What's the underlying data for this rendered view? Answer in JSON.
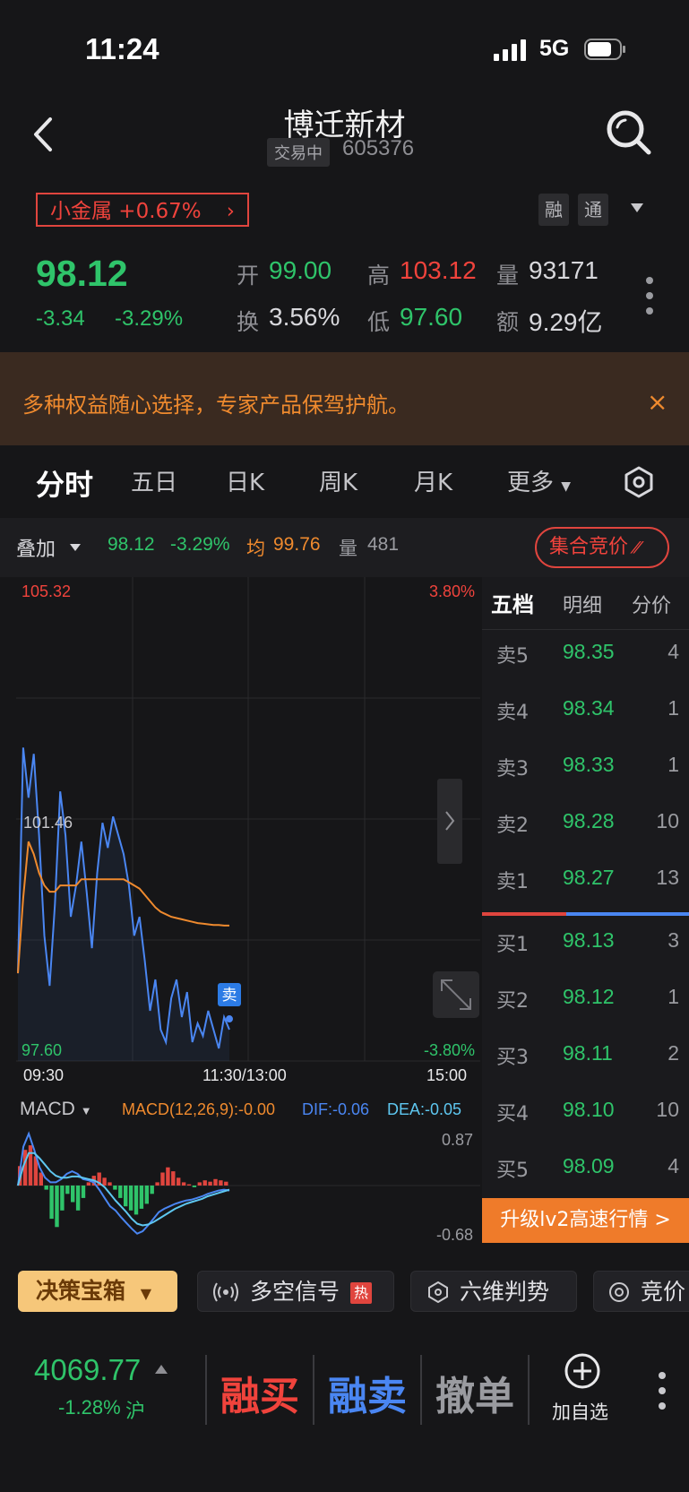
{
  "status_bar": {
    "time": "11:24",
    "network": "5G"
  },
  "header": {
    "title": "博迁新材",
    "trade_status": "交易中",
    "code": "605376"
  },
  "sector": {
    "label": "小金属 +0.67%",
    "tags": [
      "融",
      "通"
    ]
  },
  "quote": {
    "price": "98.12",
    "change": "-3.34",
    "change_pct": "-3.29%",
    "stats": [
      {
        "label": "开",
        "value": "99.00",
        "color": "#2fc46a"
      },
      {
        "label": "高",
        "value": "103.12",
        "color": "#f0433c"
      },
      {
        "label": "量",
        "value": "93171",
        "color": "#d8d8dc"
      },
      {
        "label": "换",
        "value": "3.56%",
        "color": "#d8d8dc"
      },
      {
        "label": "低",
        "value": "97.60",
        "color": "#2fc46a"
      },
      {
        "label": "额",
        "value": "9.29亿",
        "color": "#d8d8dc"
      }
    ]
  },
  "banner": {
    "text": "多种权益随心选择，专家产品保驾护航。",
    "close": "×"
  },
  "tabs": [
    "分时",
    "五日",
    "日K",
    "周K",
    "月K",
    "更多"
  ],
  "overlay": {
    "label": "叠加",
    "price": "98.12",
    "pct": "-3.29%",
    "avg_label": "均",
    "avg": "99.76",
    "vol_label": "量",
    "vol": "481",
    "auction": "集合竞价"
  },
  "chart_data": [
    {
      "type": "line",
      "title": "",
      "x_ticks": [
        "09:30",
        "11:30/13:00",
        "15:00"
      ],
      "y_max_label": "105.32",
      "y_min_label": "97.60",
      "pct_max_label": "3.80%",
      "pct_min_label": "-3.80%",
      "mid_label": "101.46",
      "ylim": [
        97.6,
        105.32
      ],
      "marker": "卖",
      "series": [
        {
          "name": "price",
          "color": "#4a86f2",
          "values": [
            99.0,
            102.6,
            101.8,
            102.5,
            101.2,
            99.6,
            98.8,
            100.1,
            101.9,
            101.2,
            99.9,
            100.4,
            101.1,
            100.3,
            99.4,
            100.6,
            101.4,
            101.0,
            101.5,
            101.2,
            100.9,
            100.4,
            99.6,
            99.9,
            99.2,
            98.4,
            98.9,
            98.1,
            97.9,
            98.6,
            98.9,
            98.3,
            98.7,
            97.9,
            98.2,
            98.0,
            98.4,
            98.1,
            97.8,
            98.3,
            98.1
          ]
        },
        {
          "name": "avg",
          "color": "#ef8a2e",
          "values": [
            99.0,
            100.2,
            101.1,
            100.9,
            100.6,
            100.4,
            100.3,
            100.3,
            100.4,
            100.4,
            100.4,
            100.4,
            100.5,
            100.5,
            100.5,
            100.5,
            100.5,
            100.5,
            100.5,
            100.5,
            100.5,
            100.45,
            100.4,
            100.35,
            100.25,
            100.15,
            100.05,
            99.98,
            99.94,
            99.9,
            99.88,
            99.86,
            99.84,
            99.82,
            99.8,
            99.79,
            99.78,
            99.77,
            99.77,
            99.76,
            99.76
          ]
        }
      ]
    },
    {
      "type": "bar",
      "title": "MACD",
      "params": "MACD(12,26,9):-0.00",
      "dif": "DIF:-0.06",
      "dea": "DEA:-0.05",
      "y_max_label": "0.87",
      "y_min_label": "-0.68",
      "ylim": [
        -0.68,
        0.87
      ],
      "values": [
        0.3,
        0.55,
        0.62,
        0.45,
        0.2,
        -0.05,
        -0.4,
        -0.5,
        -0.3,
        -0.1,
        -0.2,
        -0.3,
        -0.15,
        0.05,
        0.15,
        0.2,
        0.12,
        0.05,
        -0.05,
        -0.15,
        -0.25,
        -0.3,
        -0.35,
        -0.28,
        -0.22,
        -0.1,
        0.05,
        0.2,
        0.28,
        0.22,
        0.12,
        0.05,
        0.02,
        -0.02,
        0.05,
        0.08,
        0.06,
        0.1,
        0.08,
        0.06
      ],
      "dif_values": [
        0.0,
        0.6,
        0.8,
        0.55,
        0.28,
        0.12,
        0.05,
        0.05,
        0.1,
        0.18,
        0.22,
        0.18,
        0.1,
        0.08,
        0.05,
        -0.05,
        -0.15,
        -0.25,
        -0.3,
        -0.38,
        -0.45,
        -0.52,
        -0.58,
        -0.55,
        -0.48,
        -0.4,
        -0.32,
        -0.28,
        -0.25,
        -0.22,
        -0.2,
        -0.18,
        -0.17,
        -0.15,
        -0.13,
        -0.1,
        -0.08,
        -0.06,
        -0.05,
        -0.06
      ],
      "dea_values": [
        0.0,
        0.3,
        0.5,
        0.5,
        0.42,
        0.32,
        0.22,
        0.15,
        0.12,
        0.12,
        0.14,
        0.14,
        0.12,
        0.1,
        0.08,
        0.04,
        -0.02,
        -0.1,
        -0.18,
        -0.25,
        -0.32,
        -0.4,
        -0.46,
        -0.48,
        -0.47,
        -0.44,
        -0.4,
        -0.36,
        -0.32,
        -0.28,
        -0.25,
        -0.22,
        -0.2,
        -0.18,
        -0.16,
        -0.13,
        -0.11,
        -0.09,
        -0.07,
        -0.05
      ]
    }
  ],
  "order_book": {
    "tabs": [
      "五档",
      "明细",
      "分价"
    ],
    "asks": [
      {
        "label": "卖5",
        "price": "98.35",
        "vol": "4"
      },
      {
        "label": "卖4",
        "price": "98.34",
        "vol": "1"
      },
      {
        "label": "卖3",
        "price": "98.33",
        "vol": "1"
      },
      {
        "label": "卖2",
        "price": "98.28",
        "vol": "10"
      },
      {
        "label": "卖1",
        "price": "98.27",
        "vol": "13"
      }
    ],
    "bids": [
      {
        "label": "买1",
        "price": "98.13",
        "vol": "3"
      },
      {
        "label": "买2",
        "price": "98.12",
        "vol": "1"
      },
      {
        "label": "买3",
        "price": "98.11",
        "vol": "2"
      },
      {
        "label": "买4",
        "price": "98.10",
        "vol": "10"
      },
      {
        "label": "买5",
        "price": "98.09",
        "vol": "4"
      }
    ],
    "upgrade": "升级lv2高速行情 >"
  },
  "chips": {
    "decision": "决策宝箱",
    "signal": "多空信号",
    "hot": "热",
    "six": "六维判势",
    "auction": "竞价"
  },
  "bottom": {
    "index_value": "4069.77",
    "index_change": "-1.28%",
    "market": "沪",
    "buy": "融买",
    "sell": "融卖",
    "cancel": "撤单",
    "add_fav": "加自选"
  }
}
